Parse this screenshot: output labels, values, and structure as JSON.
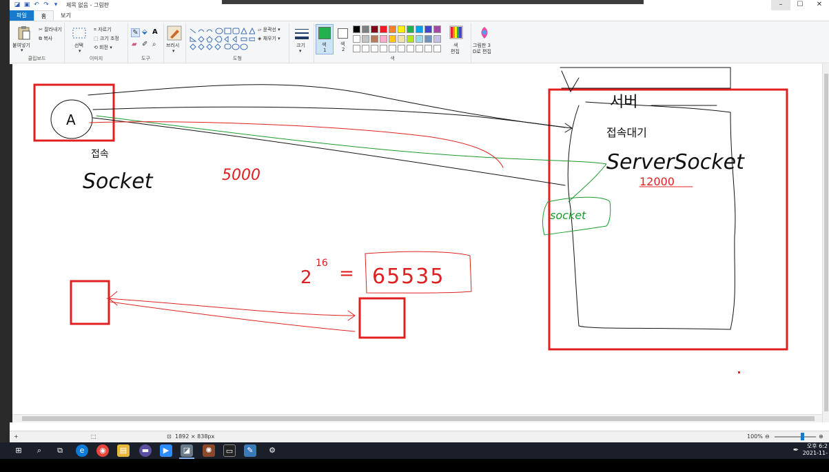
{
  "window": {
    "title": "제목 없음 - 그림판"
  },
  "tabs": [
    {
      "label": "파일"
    },
    {
      "label": "홈"
    },
    {
      "label": "보기"
    }
  ],
  "ribbon": {
    "clipboard": {
      "paste": "붙여넣기",
      "cut": "잘라내기",
      "copy": "복사",
      "group": "클립보드"
    },
    "image": {
      "select": "선택",
      "crop": "자르기",
      "resize": "크기 조정",
      "rotate": "회전",
      "group": "이미지"
    },
    "tools": {
      "group": "도구"
    },
    "brushes": {
      "label": "브러시"
    },
    "shapes": {
      "outline": "윤곽선",
      "fill": "채우기",
      "group": "도형"
    },
    "size": {
      "label": "크기"
    },
    "color1": {
      "label": "색",
      "index": "1"
    },
    "color2": {
      "label": "색",
      "index": "2"
    },
    "colors_group": "색",
    "edit_colors": {
      "line1": "색",
      "line2": "편집"
    },
    "paint3d": {
      "line1": "그림판 3",
      "line2": "D로 편집"
    },
    "palette": [
      "#000000",
      "#7f7f7f",
      "#880015",
      "#ed1c24",
      "#ff7f27",
      "#fff200",
      "#22b14c",
      "#00a2e8",
      "#3f48cc",
      "#a349a4",
      "#ffffff",
      "#c3c3c3",
      "#b97a57",
      "#ffaec9",
      "#ffc90e",
      "#efe4b0",
      "#b5e61d",
      "#99d9ea",
      "#7092be",
      "#c8bfe7"
    ],
    "color1_value": "#22b14c"
  },
  "canvas": {
    "labels": {
      "client": "A",
      "connect": "접속",
      "socket_left": "Socket",
      "server": "서버",
      "waiting": "접속대기",
      "server_socket": "ServerSocket",
      "port": "12000",
      "socket_right": "socket",
      "port_note_left": "5000",
      "formula": "2",
      "exponent": "16",
      "equals": "=",
      "max_port": "65535"
    }
  },
  "status": {
    "canvas_size": "1892 × 838px",
    "zoom": "100%"
  },
  "taskbar": {
    "clock_time": "오후 6:2",
    "clock_date": "2021-11-"
  }
}
